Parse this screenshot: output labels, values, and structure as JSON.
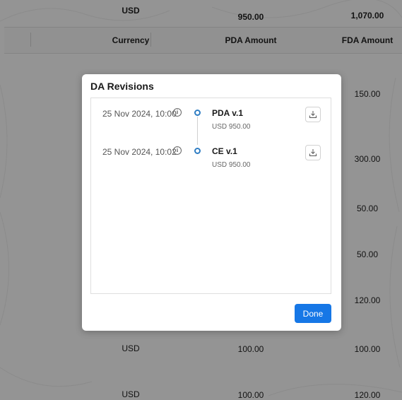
{
  "background_table": {
    "top_row": {
      "currency": "USD",
      "pda_amount": "950.00",
      "fda_amount": "1,070.00"
    },
    "headers": {
      "currency": "Currency",
      "pda_amount": "PDA Amount",
      "fda_amount": "FDA Amount"
    },
    "fda_values": [
      "150.00",
      "300.00",
      "50.00",
      "50.00",
      "120.00"
    ],
    "bottom_rows": [
      {
        "currency": "USD",
        "pda_amount": "100.00",
        "fda_amount": "100.00"
      },
      {
        "currency": "USD",
        "pda_amount": "100.00",
        "fda_amount": "120.00"
      }
    ]
  },
  "modal": {
    "title": "DA Revisions",
    "revisions": [
      {
        "date": "25 Nov 2024, 10:00",
        "name": "PDA v.1",
        "amount": "USD 950.00",
        "info_icon": "info-circle-icon",
        "download_icon": "download-icon"
      },
      {
        "date": "25 Nov 2024, 10:02",
        "name": "CE v.1",
        "amount": "USD 950.00",
        "info_icon": "info-circle-icon",
        "download_icon": "download-icon"
      }
    ],
    "done_label": "Done"
  },
  "colors": {
    "accent": "#1677e6",
    "timeline_dot": "#2f7dc3"
  }
}
